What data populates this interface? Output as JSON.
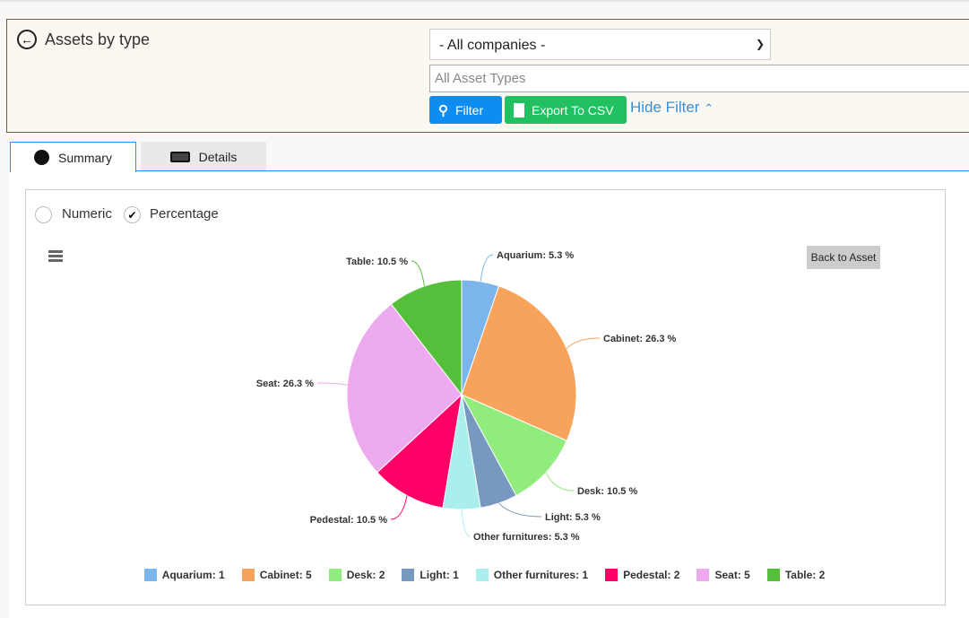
{
  "header": {
    "title": "Assets by type",
    "company_select": "- All companies -",
    "asset_types_placeholder": "All Asset Types",
    "filter_label": "Filter",
    "export_label": "Export To CSV",
    "csv_icon_text": "CSV",
    "hide_filter_label": "Hide Filter"
  },
  "tabs": [
    {
      "label": "Summary"
    },
    {
      "label": "Details"
    }
  ],
  "options": {
    "numeric": "Numeric",
    "percentage": "Percentage",
    "selected": "Percentage"
  },
  "chart": {
    "back_label": "Back to Asset"
  },
  "chart_data": {
    "type": "pie",
    "categories": [
      "Aquarium",
      "Cabinet",
      "Desk",
      "Light",
      "Other furnitures",
      "Pedestal",
      "Seat",
      "Table"
    ],
    "values": [
      1,
      5,
      2,
      1,
      1,
      2,
      5,
      2
    ],
    "data_labels": [
      "Aquarium: 5.3 %",
      "Cabinet: 26.3 %",
      "Desk: 10.5 %",
      "Light: 5.3 %",
      "Other furnitures: 5.3 %",
      "Pedestal: 10.5 %",
      "Seat: 26.3 %",
      "Table: 10.5 %"
    ],
    "legend_labels": [
      "Aquarium: 1",
      "Cabinet: 5",
      "Desk: 2",
      "Light: 1",
      "Other furnitures: 1",
      "Pedestal: 2",
      "Seat: 5",
      "Table: 2"
    ],
    "colors": [
      "#7cb5ec",
      "#f7a35c",
      "#90ed7d",
      "#7798bf",
      "#aaeeee",
      "#ff0066",
      "#eeaaee",
      "#55bf3b"
    ],
    "legend_position": "bottom"
  }
}
